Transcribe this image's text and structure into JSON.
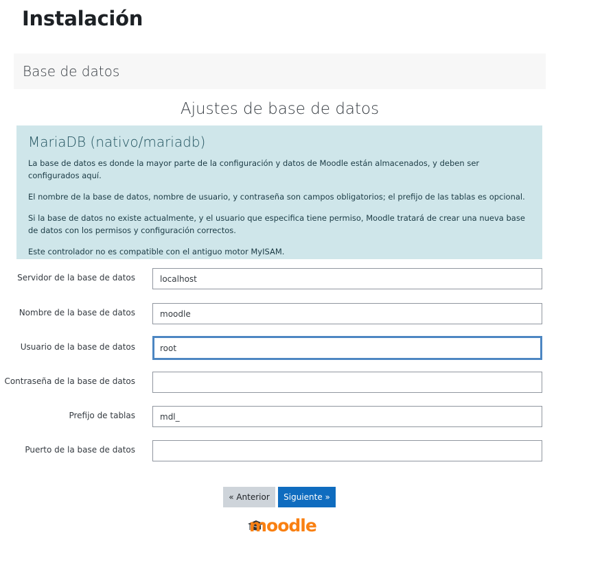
{
  "page": {
    "title": "Instalación"
  },
  "stage": {
    "label": "Base de datos"
  },
  "settings": {
    "heading": "Ajustes de base de datos"
  },
  "info": {
    "title": "MariaDB (nativo/mariadb)",
    "paragraphs": [
      "La base de datos es donde la mayor parte de la configuración y datos de Moodle están almacenados, y deben ser configurados aquí.",
      "El nombre de la base de datos, nombre de usuario, y contraseña son campos obligatorios; el prefijo de las tablas es opcional.",
      "Si la base de datos no existe actualmente, y el usuario que especifica tiene permiso, Moodle tratará de crear una nueva base de datos con los permisos y configuración correctos.",
      "Este controlador no es compatible con el antiguo motor MyISAM."
    ]
  },
  "form": {
    "fields": [
      {
        "label": "Servidor de la base de datos",
        "value": "localhost"
      },
      {
        "label": "Nombre de la base de datos",
        "value": "moodle"
      },
      {
        "label": "Usuario de la base de datos",
        "value": "root"
      },
      {
        "label": "Contraseña de la base de datos",
        "value": ""
      },
      {
        "label": "Prefijo de tablas",
        "value": "mdl_"
      },
      {
        "label": "Puerto de la base de datos",
        "value": ""
      }
    ]
  },
  "buttons": {
    "previous": "« Anterior",
    "next": "Siguiente »"
  },
  "logo": {
    "text": "moodle",
    "icon": "mortarboard-icon"
  },
  "colors": {
    "accent": "#0f6cbf",
    "info_bg": "#cfe6ea",
    "logo": "#f98012",
    "focus": "#4c86c2"
  }
}
